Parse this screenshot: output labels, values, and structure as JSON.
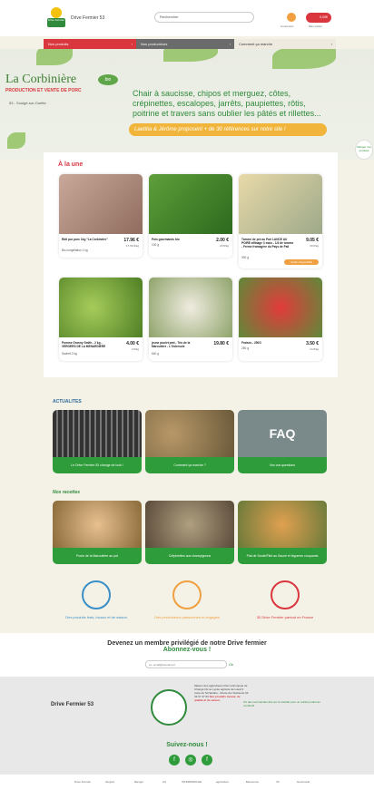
{
  "header": {
    "brand": "Drive Fermier 53",
    "logo_text": "Drive Fermier",
    "search_placeholder": "Rechercher",
    "connexion_label": "Connexion",
    "cart_label": "Mon panier",
    "cart_amount": "0,00€"
  },
  "nav": [
    {
      "label": "Nos produits",
      "arrow": "›"
    },
    {
      "label": "Nos producteurs",
      "arrow": "›"
    },
    {
      "label": "Comment ça marche",
      "arrow": "›"
    }
  ],
  "hero": {
    "title": "La Corbinière",
    "bio": "bio",
    "subtitle": "PRODUCTION ET VENTE DE PORC",
    "location": "53 - Soulgé-sur-Ouette",
    "text": "Chair à saucisse, chipos et merguez, côtes, crépinettes, escalopes, jarrêts, paupiettes, rôtis, poitrine et travers sans oublier les pâtés et rillettes...",
    "strip": "Laetitia & Jérôme proposent + de 30 références sur notre site !",
    "badge": "Manger nos produits"
  },
  "featured": {
    "title": "À la une",
    "products": [
      {
        "name": "Rôti pur porc 1kg \"La Corbinière\"",
        "sub": "Bio congélation 1 kg",
        "price": "17.96 €",
        "unit": "17.96 €/kg",
        "button": ""
      },
      {
        "name": "Pois gourmands bio",
        "sub": "100 g",
        "price": "2.00 €",
        "unit": "20 €/kg",
        "button": ""
      },
      {
        "name": "Tomme de pré au Pari LANCE AU POIRE affinage 3 mois - 1/4 de tomme - Ferme fromagère du Pays de Pail",
        "sub": "300 g",
        "price": "9.05 €",
        "unit": "30 €/kg",
        "button": "Vérifier disponibilité"
      },
      {
        "name": "Pomme Granny Smith - 2 kg - VERGERS DE LA MENARDIERE",
        "sub": "Sachet 2 kg",
        "price": "4.00 €",
        "unit": "2 €/kg",
        "button": ""
      },
      {
        "name": "jeune poulet pmt - Trio de la Maroutière - L'Ostresole",
        "sub": "640 g",
        "price": "19.80 €",
        "unit": "",
        "button": ""
      },
      {
        "name": "Fraises - 250G",
        "sub": "250 g",
        "price": "3.50 €",
        "unit": "14 €/kg",
        "button": ""
      }
    ]
  },
  "news": {
    "title": "ACTUALITES",
    "items": [
      {
        "caption": "Le Drive Fermier 53 change de look !"
      },
      {
        "caption": "Comment ça marche ?"
      },
      {
        "caption": "Vos vos questions"
      }
    ],
    "faq_text": "FAQ"
  },
  "recipes": {
    "title": "Nos recettes",
    "items": [
      {
        "caption": "Poule de la Maroutière au pot"
      },
      {
        "caption": "Crêpinettes aux champignons"
      },
      {
        "caption": "Plat de Sauté/Filet au Sauvé et légumes croquants"
      }
    ]
  },
  "values": [
    {
      "label": "Des produits frais, locaux et de saison",
      "color": "#3a8fc7"
    },
    {
      "label": "Des producteurs passionnés et engagés",
      "color": "#f0a040"
    },
    {
      "label": "30 Drive Fermier partout en France",
      "color": "#d9363e"
    }
  ],
  "member": {
    "line1": "Devenez un membre privilégié de notre Drive fermier",
    "line2": "Abonnez-vous !",
    "email_placeholder": "ex: email@domaine.fr",
    "ok": "Ok"
  },
  "footer": {
    "brand": "Drive Fermier 53",
    "address": "Maison des agriculteurs Parc technopole de Changé Où se Lycée agricole de Laval 3 route de St Nazaire - Route de l'Huisserie 02 43 67 37 00",
    "address_red": "Des produits locaux, de qualité et de saison.",
    "right": "Où des commandes fixé sur le résultat pour un retrait produit au vendredi!",
    "follow": "Suivez-nous !",
    "social": [
      "f",
      "◎",
      "f"
    ]
  },
  "partners": [
    "Drive Fermier",
    "Vergers",
    "Manger",
    "CA",
    "INTERMARCHE",
    "agriculture",
    "Bienvenue",
    "53",
    "Gourmand"
  ]
}
